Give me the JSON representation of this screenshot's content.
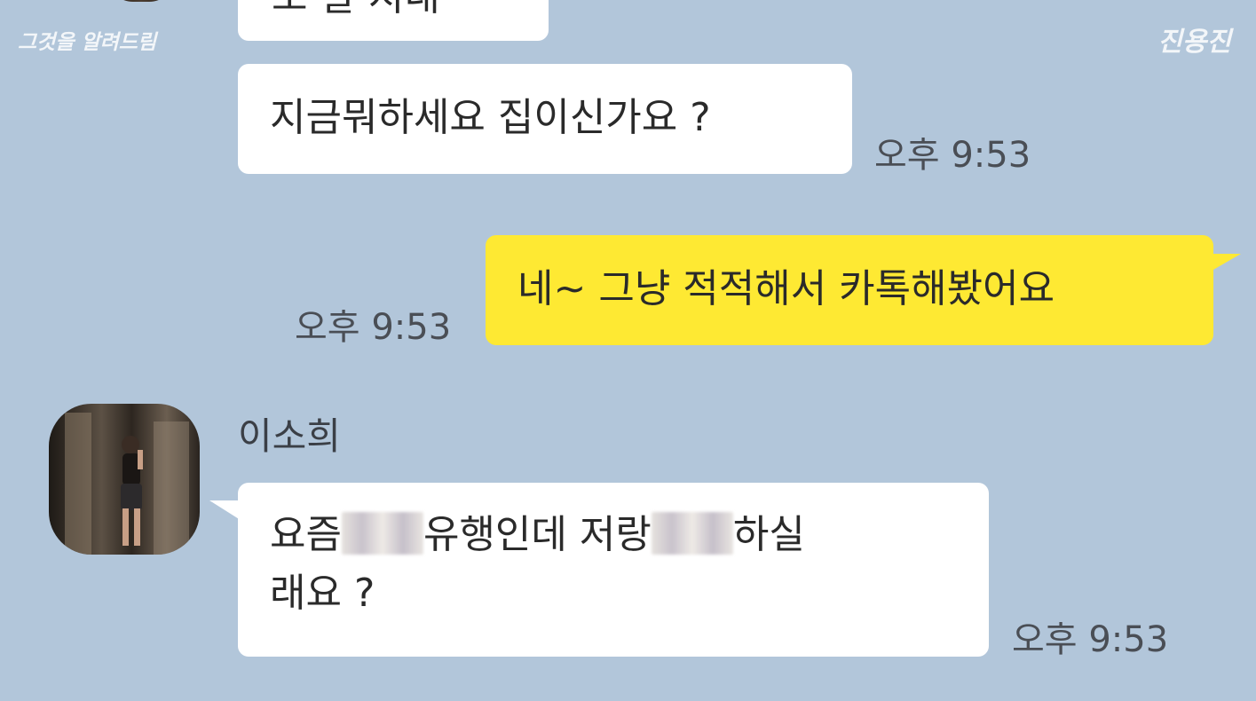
{
  "watermark": {
    "left": "그것을 알려드림",
    "right": "진용진"
  },
  "chat": {
    "cutoff_message": "조 잘 지내",
    "message1": {
      "text": "지금뭐하세요 집이신가요 ?",
      "time": "오후 9:53"
    },
    "message2": {
      "text": "네~ 그냥 적적해서 카톡해봤어요",
      "time": "오후 9:53"
    },
    "sender": {
      "name": "이소희",
      "avatar_icon": "profile-photo"
    },
    "message3": {
      "part1": "요즘",
      "part2": "유행인데 저랑",
      "part3": "하실",
      "line2": "래요 ?",
      "time": "오후 9:53"
    }
  },
  "colors": {
    "background": "#b2c6da",
    "my_bubble": "#fee933",
    "other_bubble": "#ffffff"
  }
}
